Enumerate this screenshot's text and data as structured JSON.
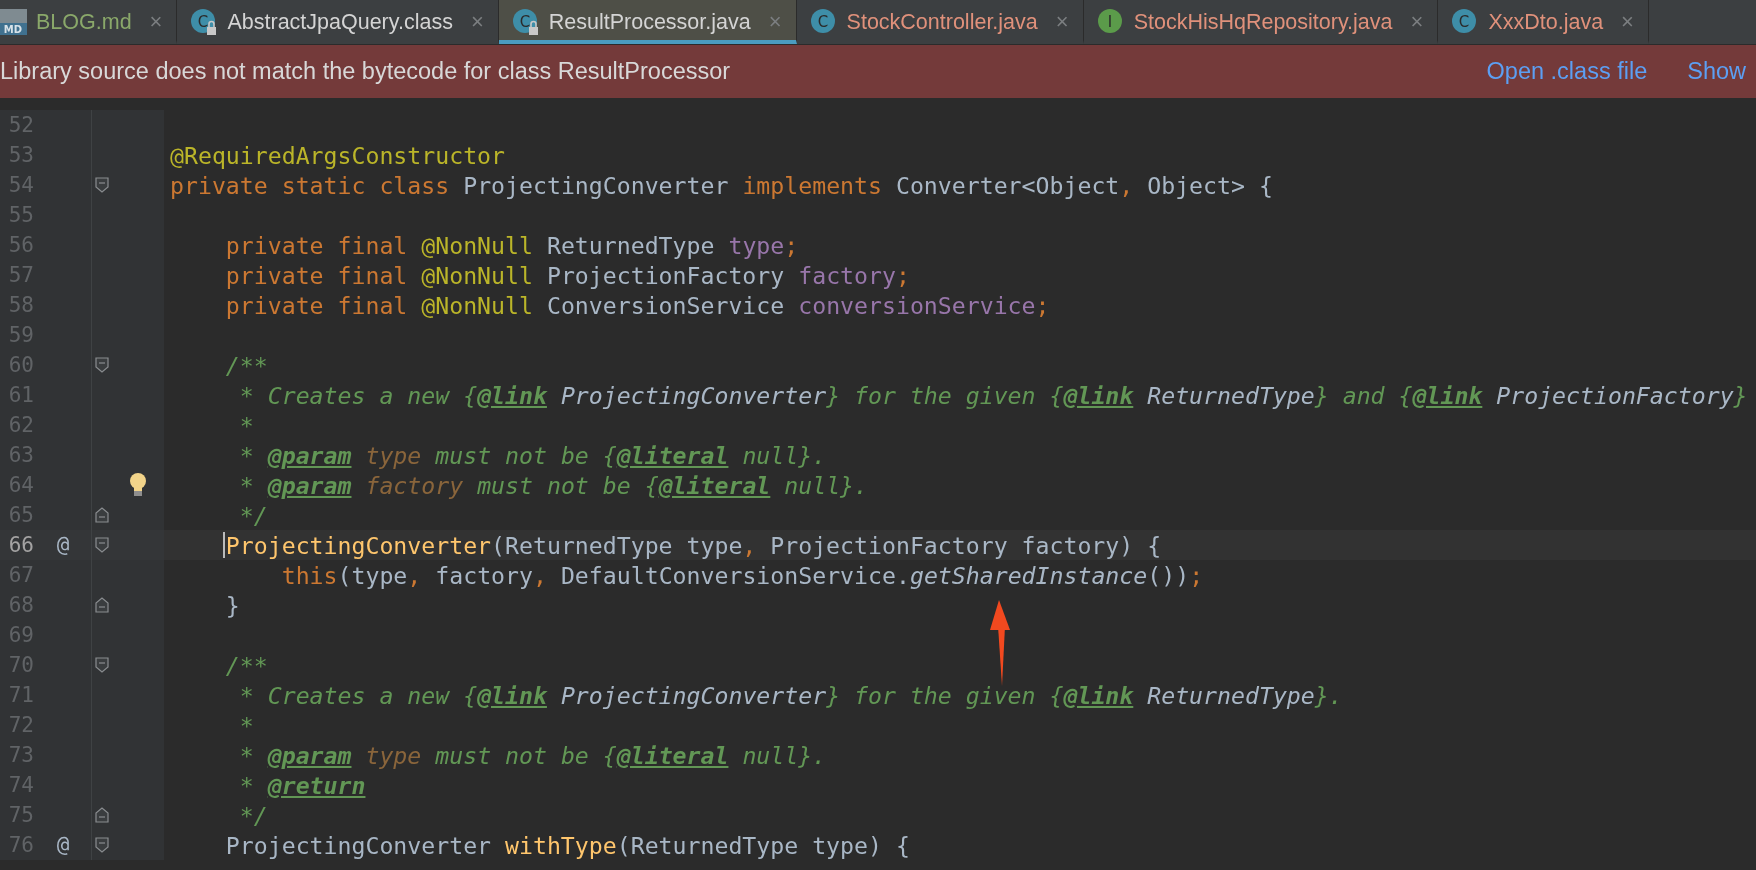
{
  "tabs": [
    {
      "label": "BLOG.md",
      "kind": "markdown",
      "icon_letter": "MD",
      "color": "#8aa86a",
      "close": "×",
      "selected": false
    },
    {
      "label": "AbstractJpaQuery.class",
      "kind": "class",
      "icon_letter": "C",
      "locked": true,
      "color": "#d4d4d4",
      "close": "×",
      "selected": false
    },
    {
      "label": "ResultProcessor.java",
      "kind": "class",
      "icon_letter": "C",
      "locked": true,
      "color": "#d4d4d4",
      "close": "×",
      "selected": true
    },
    {
      "label": "StockController.java",
      "kind": "class",
      "icon_letter": "C",
      "locked": false,
      "color": "#e0917b",
      "close": "×",
      "selected": false
    },
    {
      "label": "StockHisHqRepository.java",
      "kind": "interface",
      "icon_letter": "I",
      "locked": false,
      "color": "#e0917b",
      "close": "×",
      "selected": false
    },
    {
      "label": "XxxDto.java",
      "kind": "class",
      "icon_letter": "C",
      "locked": false,
      "color": "#e0917b",
      "close": "×",
      "selected": false
    }
  ],
  "banner": {
    "message": "Library source does not match the bytecode for class ResultProcessor",
    "links": [
      "Open .class file",
      "Show"
    ]
  },
  "lines": [
    {
      "number": "52",
      "current": false
    },
    {
      "number": "53",
      "current": false,
      "tokens": [
        {
          "kind": "ann",
          "text": "@RequiredArgsConstructor"
        }
      ]
    },
    {
      "number": "54",
      "gutter_icons": [
        {
          "kind": "fold-start"
        }
      ],
      "current": false,
      "tokens": [
        {
          "kind": "kw",
          "text": "private static class "
        },
        {
          "kind": "plain",
          "text": "ProjectingConverter "
        },
        {
          "kind": "kw",
          "text": "implements "
        },
        {
          "kind": "plain",
          "text": "Converter<Object"
        },
        {
          "kind": "punct",
          "text": ", "
        },
        {
          "kind": "plain",
          "text": "Object> {"
        }
      ],
      "children": [
        {
          "number": "55",
          "current": false
        },
        {
          "number": "56",
          "current": false,
          "tokens": [
            {
              "kind": "kw",
              "text": "private final "
            },
            {
              "kind": "ann",
              "text": "@NonNull"
            },
            {
              "kind": "plain",
              "text": " ReturnedType "
            },
            {
              "kind": "field",
              "text": "type"
            },
            {
              "kind": "punct",
              "text": ";"
            }
          ]
        },
        {
          "number": "57",
          "current": false,
          "tokens": [
            {
              "kind": "kw",
              "text": "private final "
            },
            {
              "kind": "ann",
              "text": "@NonNull"
            },
            {
              "kind": "plain",
              "text": " ProjectionFactory "
            },
            {
              "kind": "field",
              "text": "factory"
            },
            {
              "kind": "punct",
              "text": ";"
            }
          ]
        },
        {
          "number": "58",
          "current": false,
          "tokens": [
            {
              "kind": "kw",
              "text": "private final "
            },
            {
              "kind": "ann",
              "text": "@NonNull"
            },
            {
              "kind": "plain",
              "text": " ConversionService "
            },
            {
              "kind": "field",
              "text": "conversionService"
            },
            {
              "kind": "punct",
              "text": ";"
            }
          ]
        },
        {
          "number": "59",
          "current": false
        },
        {
          "number": "60",
          "gutter_icons": [
            {
              "kind": "fold-start"
            }
          ],
          "current": false,
          "tokens": [
            {
              "kind": "doc",
              "text": "/**"
            }
          ]
        },
        {
          "number": "61",
          "kind": "doc-body",
          "current": false,
          "tokens": [
            {
              "kind": "doc",
              "text": "* Creates a new {"
            },
            {
              "kind": "tag",
              "text": "@link"
            },
            {
              "kind": "ref",
              "text": " ProjectingConverter"
            },
            {
              "kind": "doc",
              "text": "} for the given {"
            },
            {
              "kind": "tag",
              "text": "@link"
            },
            {
              "kind": "ref",
              "text": " ReturnedType"
            },
            {
              "kind": "doc",
              "text": "} and {"
            },
            {
              "kind": "tag",
              "text": "@link"
            },
            {
              "kind": "ref",
              "text": " ProjectionFactory"
            },
            {
              "kind": "doc",
              "text": "}"
            }
          ]
        },
        {
          "number": "62",
          "kind": "doc-body",
          "current": false,
          "tokens": [
            {
              "kind": "doc",
              "text": "*"
            }
          ]
        },
        {
          "number": "63",
          "kind": "doc-body",
          "current": false,
          "tokens": [
            {
              "kind": "doc",
              "text": "* "
            },
            {
              "kind": "tag",
              "text": "@param"
            },
            {
              "kind": "param",
              "text": " type"
            },
            {
              "kind": "doc",
              "text": " must not be {"
            },
            {
              "kind": "tag",
              "text": "@literal"
            },
            {
              "kind": "doc",
              "text": " null}."
            }
          ]
        },
        {
          "number": "64",
          "kind": "doc-body",
          "gutter_icons": [
            {
              "kind": "bulb"
            }
          ],
          "current": false,
          "tokens": [
            {
              "kind": "doc",
              "text": "* "
            },
            {
              "kind": "tag",
              "text": "@param"
            },
            {
              "kind": "param",
              "text": " factory"
            },
            {
              "kind": "doc",
              "text": " must not be {"
            },
            {
              "kind": "tag",
              "text": "@literal"
            },
            {
              "kind": "doc",
              "text": " null}."
            }
          ]
        },
        {
          "number": "65",
          "kind": "doc-body",
          "gutter_icons": [
            {
              "kind": "fold-end"
            }
          ],
          "current": false,
          "tokens": [
            {
              "kind": "doc",
              "text": "*/"
            }
          ]
        },
        {
          "number": "66",
          "mark": "@",
          "gutter_icons": [
            {
              "kind": "fold-start"
            }
          ],
          "current": true,
          "tokens": [
            {
              "kind": "method",
              "text": "ProjectingConverter"
            },
            {
              "kind": "plain",
              "text": "(ReturnedType type"
            },
            {
              "kind": "punct",
              "text": ", "
            },
            {
              "kind": "plain",
              "text": "ProjectionFactory factory) {"
            }
          ],
          "children": [
            {
              "number": "67",
              "current": false,
              "tokens": [
                {
                  "kind": "kw",
                  "text": "this"
                },
                {
                  "kind": "plain",
                  "text": "(type"
                },
                {
                  "kind": "punct",
                  "text": ", "
                },
                {
                  "kind": "plain",
                  "text": "factory"
                },
                {
                  "kind": "punct",
                  "text": ", "
                },
                {
                  "kind": "plain",
                  "text": "DefaultConversionService."
                },
                {
                  "kind": "call",
                  "text": "getSharedInstance"
                },
                {
                  "kind": "plain",
                  "text": "())"
                },
                {
                  "kind": "punct",
                  "text": ";"
                }
              ]
            }
          ]
        },
        {
          "number": "68",
          "gutter_icons": [
            {
              "kind": "fold-end"
            }
          ],
          "current": false,
          "tokens": [
            {
              "kind": "plain",
              "text": "}"
            }
          ]
        },
        {
          "number": "69",
          "current": false
        },
        {
          "number": "70",
          "gutter_icons": [
            {
              "kind": "fold-start"
            }
          ],
          "current": false,
          "tokens": [
            {
              "kind": "doc",
              "text": "/**"
            }
          ]
        },
        {
          "number": "71",
          "kind": "doc-body",
          "current": false,
          "tokens": [
            {
              "kind": "doc",
              "text": "* Creates a new {"
            },
            {
              "kind": "tag",
              "text": "@link"
            },
            {
              "kind": "ref",
              "text": " ProjectingConverter"
            },
            {
              "kind": "doc",
              "text": "} for the given {"
            },
            {
              "kind": "tag",
              "text": "@link"
            },
            {
              "kind": "ref",
              "text": " ReturnedType"
            },
            {
              "kind": "doc",
              "text": "}."
            }
          ]
        },
        {
          "number": "72",
          "kind": "doc-body",
          "current": false,
          "tokens": [
            {
              "kind": "doc",
              "text": "*"
            }
          ]
        },
        {
          "number": "73",
          "kind": "doc-body",
          "current": false,
          "tokens": [
            {
              "kind": "doc",
              "text": "* "
            },
            {
              "kind": "tag",
              "text": "@param"
            },
            {
              "kind": "param",
              "text": " type"
            },
            {
              "kind": "doc",
              "text": " must not be {"
            },
            {
              "kind": "tag",
              "text": "@literal"
            },
            {
              "kind": "doc",
              "text": " null}."
            }
          ]
        },
        {
          "number": "74",
          "kind": "doc-body",
          "current": false,
          "tokens": [
            {
              "kind": "doc",
              "text": "* "
            },
            {
              "kind": "tag",
              "text": "@return"
            }
          ]
        },
        {
          "number": "75",
          "kind": "doc-body",
          "gutter_icons": [
            {
              "kind": "fold-end"
            }
          ],
          "current": false,
          "tokens": [
            {
              "kind": "doc",
              "text": "*/"
            }
          ]
        },
        {
          "number": "76",
          "mark": "@",
          "gutter_icons": [
            {
              "kind": "fold-start"
            }
          ],
          "current": false,
          "tokens": [
            {
              "kind": "plain",
              "text": "ProjectingConverter "
            },
            {
              "kind": "method",
              "text": "withType"
            },
            {
              "kind": "plain",
              "text": "(ReturnedType type) {"
            }
          ]
        }
      ]
    }
  ],
  "annotations": [
    {
      "kind": "arrow"
    }
  ]
}
